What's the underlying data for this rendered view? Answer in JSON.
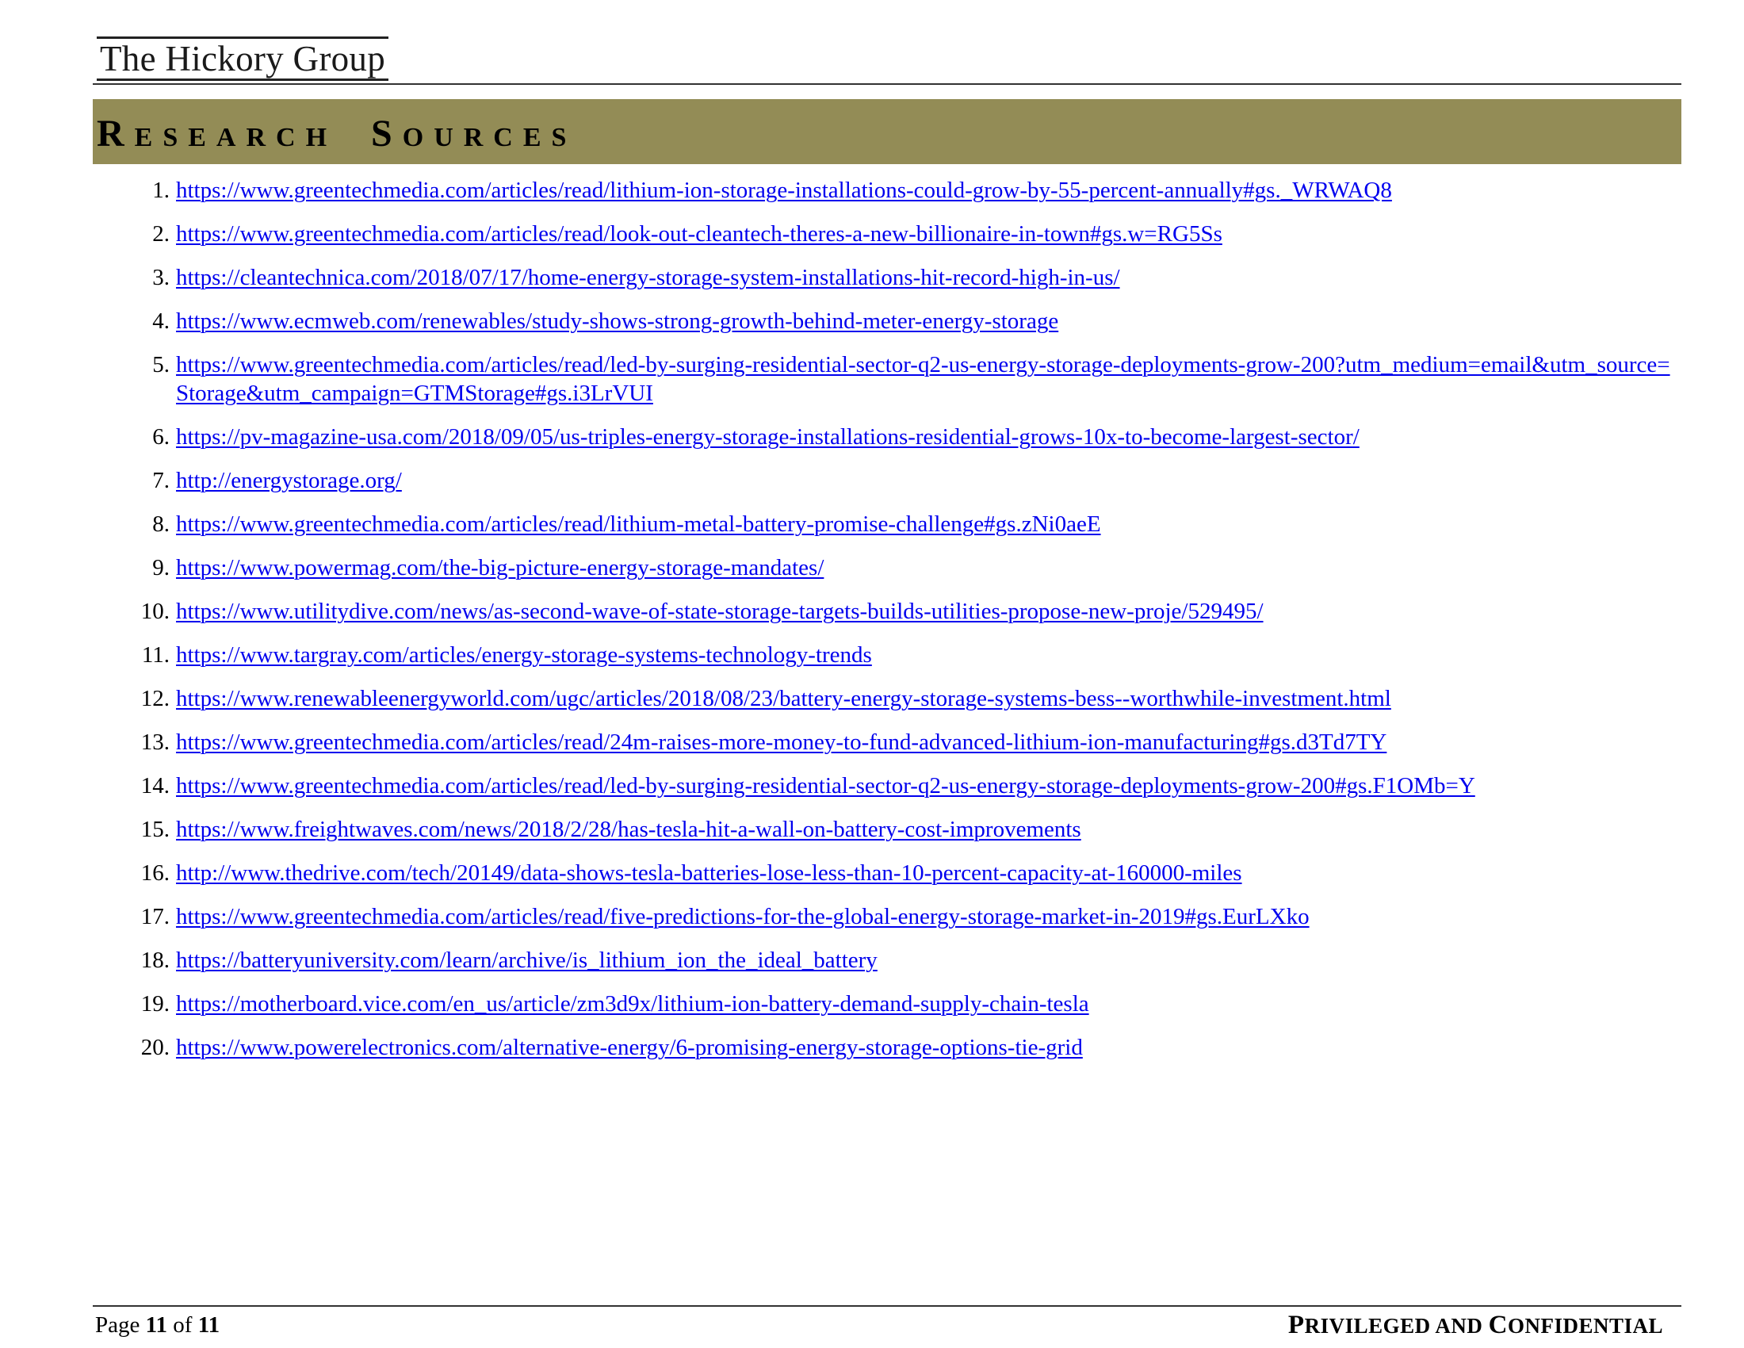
{
  "header": {
    "company": "The Hickory Group",
    "section_title_parts": [
      {
        "cap": "R",
        "rest": "ESEARCH"
      },
      {
        "cap": "S",
        "rest": "OURCES"
      }
    ]
  },
  "sources": [
    {
      "num": "1.",
      "url": "https://www.greentechmedia.com/articles/read/lithium-ion-storage-installations-could-grow-by-55-percent-annually#gs._WRWAQ8"
    },
    {
      "num": "2.",
      "url": "https://www.greentechmedia.com/articles/read/look-out-cleantech-theres-a-new-billionaire-in-town#gs.w=RG5Ss"
    },
    {
      "num": "3.",
      "url": "https://cleantechnica.com/2018/07/17/home-energy-storage-system-installations-hit-record-high-in-us/"
    },
    {
      "num": "4.",
      "url": "https://www.ecmweb.com/renewables/study-shows-strong-growth-behind-meter-energy-storage"
    },
    {
      "num": "5.",
      "url": "https://www.greentechmedia.com/articles/read/led-by-surging-residential-sector-q2-us-energy-storage-deployments-grow-200?utm_medium=email&utm_source=Storage&utm_campaign=GTMStorage#gs.i3LrVUI"
    },
    {
      "num": "6.",
      "url": "https://pv-magazine-usa.com/2018/09/05/us-triples-energy-storage-installations-residential-grows-10x-to-become-largest-sector/"
    },
    {
      "num": "7.",
      "url": "http://energystorage.org/"
    },
    {
      "num": "8.",
      "url": "https://www.greentechmedia.com/articles/read/lithium-metal-battery-promise-challenge#gs.zNi0aeE"
    },
    {
      "num": "9.",
      "url": "https://www.powermag.com/the-big-picture-energy-storage-mandates/"
    },
    {
      "num": "10.",
      "url": "https://www.utilitydive.com/news/as-second-wave-of-state-storage-targets-builds-utilities-propose-new-proje/529495/"
    },
    {
      "num": "11.",
      "url": "https://www.targray.com/articles/energy-storage-systems-technology-trends"
    },
    {
      "num": "12.",
      "url": "https://www.renewableenergyworld.com/ugc/articles/2018/08/23/battery-energy-storage-systems-bess--worthwhile-investment.html"
    },
    {
      "num": "13.",
      "url": "https://www.greentechmedia.com/articles/read/24m-raises-more-money-to-fund-advanced-lithium-ion-manufacturing#gs.d3Td7TY"
    },
    {
      "num": "14.",
      "url": "https://www.greentechmedia.com/articles/read/led-by-surging-residential-sector-q2-us-energy-storage-deployments-grow-200#gs.F1OMb=Y"
    },
    {
      "num": "15.",
      "url": "https://www.freightwaves.com/news/2018/2/28/has-tesla-hit-a-wall-on-battery-cost-improvements"
    },
    {
      "num": "16.",
      "url": "http://www.thedrive.com/tech/20149/data-shows-tesla-batteries-lose-less-than-10-percent-capacity-at-160000-miles"
    },
    {
      "num": "17.",
      "url": "https://www.greentechmedia.com/articles/read/five-predictions-for-the-global-energy-storage-market-in-2019#gs.EurLXko"
    },
    {
      "num": "18.",
      "url": "https://batteryuniversity.com/learn/archive/is_lithium_ion_the_ideal_battery"
    },
    {
      "num": "19.",
      "url": "https://motherboard.vice.com/en_us/article/zm3d9x/lithium-ion-battery-demand-supply-chain-tesla"
    },
    {
      "num": "20.",
      "url": "https://www.powerelectronics.com/alternative-energy/6-promising-energy-storage-options-tie-grid"
    }
  ],
  "footer": {
    "page_word": "Page",
    "page_current": "11",
    "of_word": "of",
    "page_total": "11",
    "confidential_parts": [
      {
        "cap": "P",
        "rest": "RIVILEGED AND"
      },
      {
        "cap": "C",
        "rest": "ONFIDENTIAL"
      }
    ]
  },
  "colors": {
    "banner": "#938c56",
    "link": "#0000ee"
  }
}
